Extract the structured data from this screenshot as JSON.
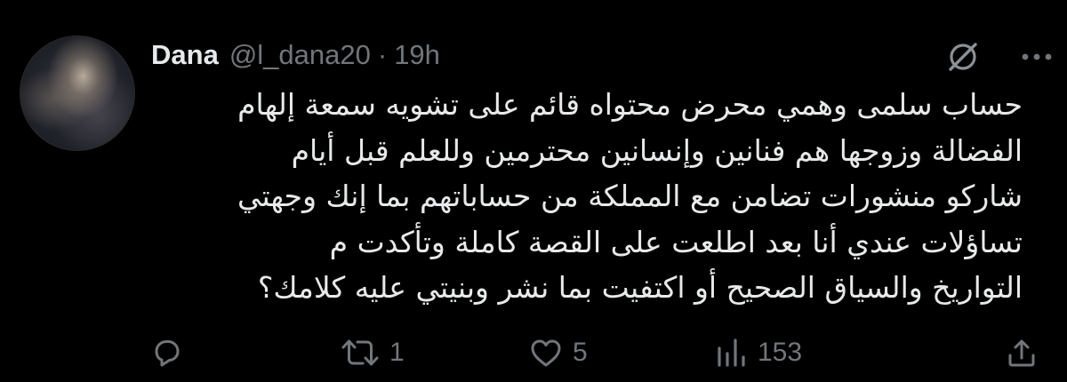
{
  "tweet": {
    "author_name": "Dana",
    "handle": "@l_dana20",
    "separator": "·",
    "time": "19h",
    "text_lines": [
      "حساب سلمى وهمي محرض محتواه قائم على تشويه سمعة إلهام",
      "الفضالة وزوجها هم فنانين وإنسانين محترمين وللعلم قبل أيام",
      "شاركو منشورات تضامن مع المملكة من حساباتهم بما إنك وجهتي",
      "تساؤلات عندي أنا بعد اطلعت على القصة كاملة وتأكدت م",
      "التواريخ والسياق الصحيح أو اكتفيت بما نشر وبنيتي عليه كلامك؟"
    ]
  },
  "actions": {
    "reply": {
      "icon": "reply-icon",
      "count": ""
    },
    "retweet": {
      "icon": "retweet-icon",
      "count": "1"
    },
    "like": {
      "icon": "heart-icon",
      "count": "5"
    },
    "views": {
      "icon": "analytics-icon",
      "count": "153"
    },
    "share": {
      "icon": "share-icon",
      "count": ""
    }
  },
  "header_icons": {
    "grok": "grok-icon",
    "more": "more-options-icon"
  },
  "colors": {
    "background": "#000000",
    "primary_text": "#e7e9ea",
    "secondary_text": "#71767b"
  }
}
